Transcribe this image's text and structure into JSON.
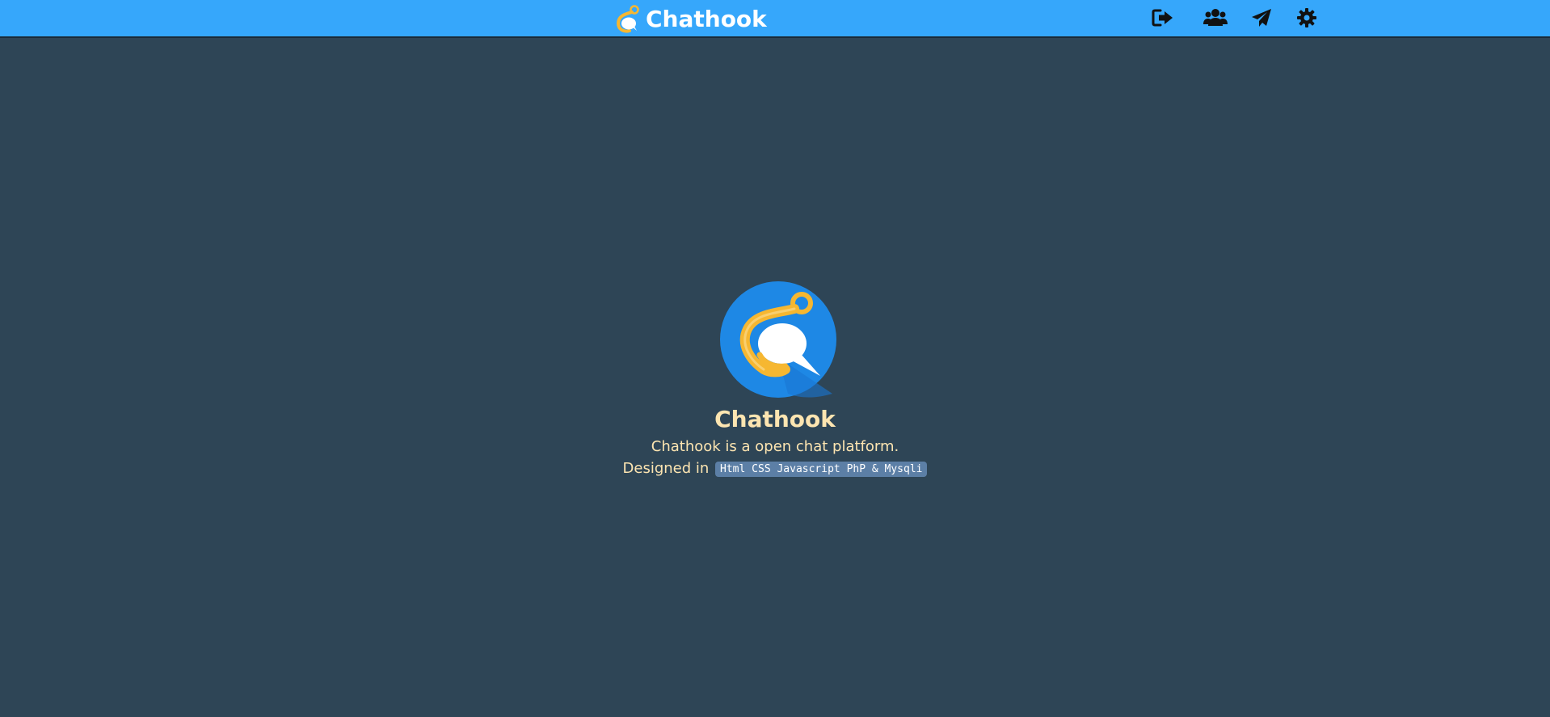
{
  "header": {
    "brand_title": "Chathook",
    "nav": [
      {
        "name": "logout",
        "icon": "sign-out-icon"
      },
      {
        "name": "users",
        "icon": "users-icon"
      },
      {
        "name": "send",
        "icon": "paper-plane-icon"
      },
      {
        "name": "settings",
        "icon": "gear-icon"
      }
    ]
  },
  "hero": {
    "title": "Chathook",
    "description": "Chathook is a open chat platform.",
    "designed_prefix": "Designed in",
    "tech_stack": "Html CSS Javascript PhP & Mysqli"
  },
  "colors": {
    "header_bg": "#36a7fb",
    "page_bg": "#2e4556",
    "text_accent": "#fde5b1",
    "badge_bg": "#5c7fa6",
    "logo_circle": "#1e88e5",
    "hook_gold": "#f6b731"
  }
}
